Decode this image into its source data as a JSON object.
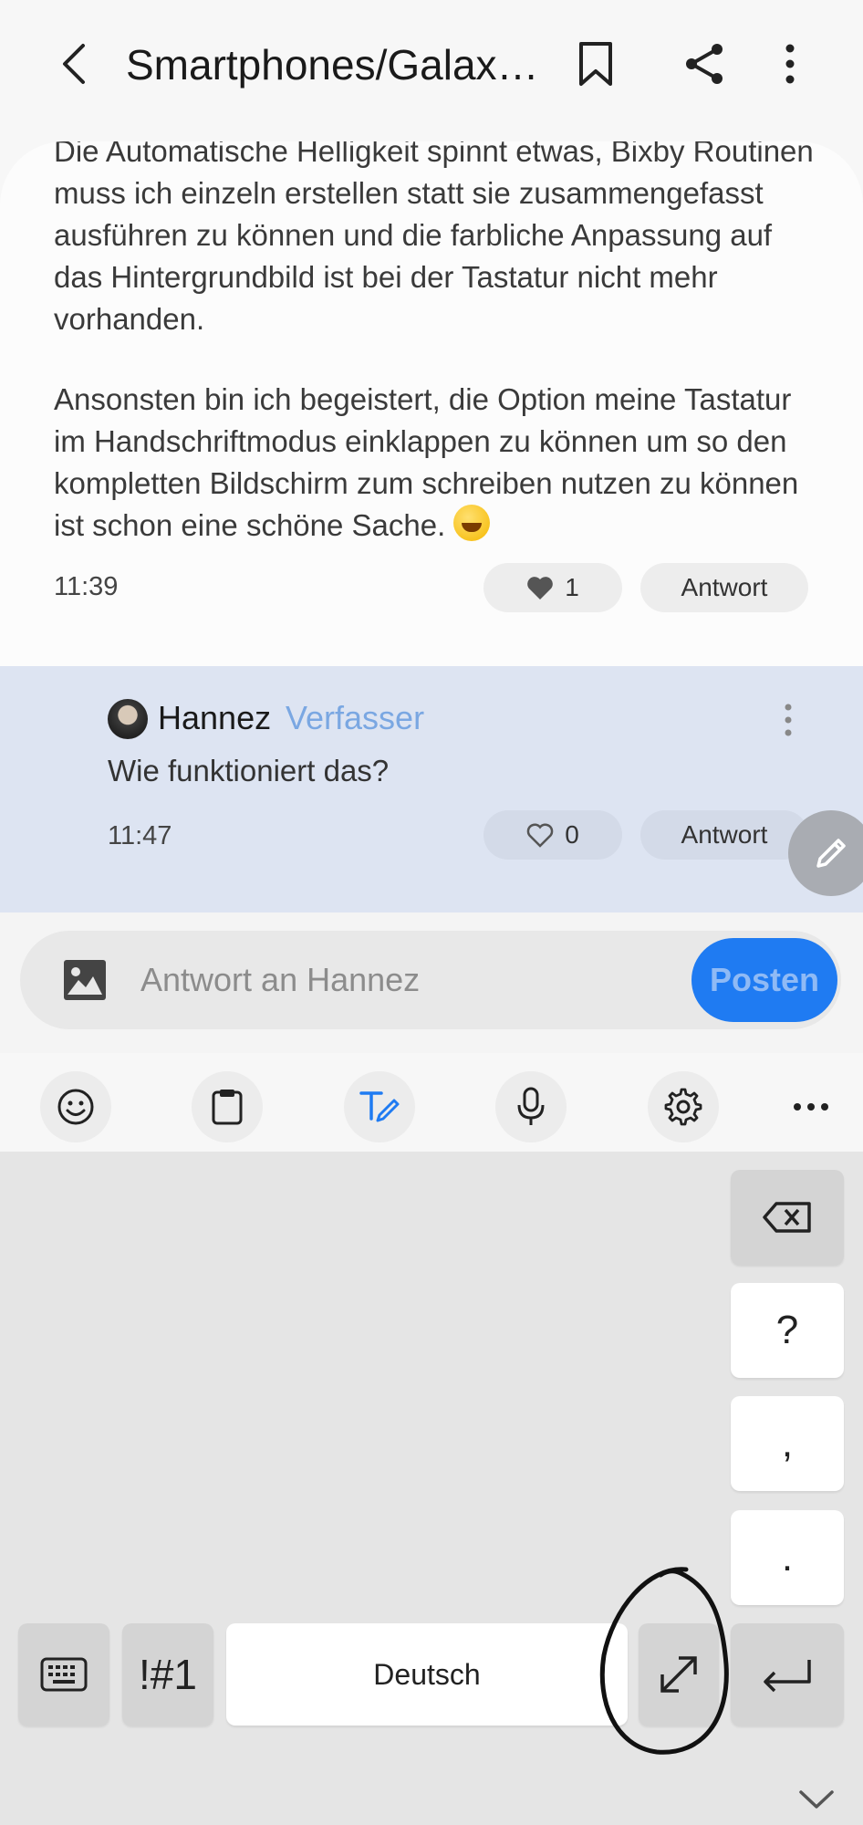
{
  "header": {
    "title": "Smartphones/Galax…",
    "icons": [
      "back-arrow-icon",
      "bookmark-icon",
      "share-icon",
      "more-vertical-icon"
    ]
  },
  "post": {
    "paragraph1": "Die Automatische Helligkeit spinnt etwas, Bixby Routinen muss ich einzeln erstellen statt sie zusammengefasst ausführen zu können und die farbliche Anpassung auf das Hintergrundbild ist bei der Tastatur nicht mehr vorhanden.",
    "paragraph2": "Ansonsten bin ich begeistert, die Option meine Tastatur im Handschriftmodus einklappen zu können um so den kompletten Bildschirm zum schreiben nutzen zu können ist schon eine schöne Sache.",
    "time": "11:39",
    "likes": "1",
    "reply_label": "Antwort"
  },
  "reply": {
    "author": "Hannez",
    "badge": "Verfasser",
    "text": "Wie funktioniert das?",
    "time": "11:47",
    "likes": "0",
    "reply_label": "Antwort"
  },
  "composer": {
    "placeholder": "Antwort an Hannez",
    "post_label": "Posten"
  },
  "keyboard": {
    "toolbar_icons": [
      "emoji-icon",
      "clipboard-icon",
      "handwriting-icon",
      "microphone-icon",
      "settings-icon",
      "more-horizontal-icon"
    ],
    "question": "?",
    "comma": ",",
    "period": ".",
    "symbols": "!#1",
    "space_label": "Deutsch"
  },
  "colors": {
    "accent": "#1f7bf2",
    "highlight_bg": "#dde4f2",
    "badge": "#7aa7e2"
  }
}
